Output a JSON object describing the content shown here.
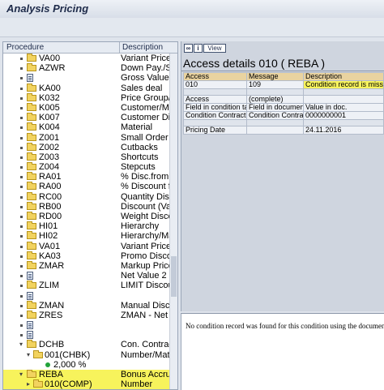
{
  "title": "Analysis Pricing",
  "tree": {
    "headers": {
      "procedure": "Procedure",
      "description": "Description"
    },
    "rows": [
      {
        "proc": "VA00",
        "desc": "Variant Price",
        "icon": "folder",
        "level": 1
      },
      {
        "proc": "AZWR",
        "desc": "Down Pay./Se",
        "icon": "folder",
        "level": 1
      },
      {
        "proc": "",
        "desc": "Gross Value",
        "icon": "doc",
        "level": 1
      },
      {
        "proc": "KA00",
        "desc": "Sales deal",
        "icon": "folder",
        "level": 1
      },
      {
        "proc": "K032",
        "desc": "Price Group/M",
        "icon": "folder",
        "level": 1
      },
      {
        "proc": "K005",
        "desc": "Customer/Mat",
        "icon": "folder",
        "level": 1
      },
      {
        "proc": "K007",
        "desc": "Customer Disc",
        "icon": "folder",
        "level": 1
      },
      {
        "proc": "K004",
        "desc": "Material",
        "icon": "folder",
        "level": 1
      },
      {
        "proc": "Z001",
        "desc": "Small Order",
        "icon": "folder",
        "level": 1
      },
      {
        "proc": "Z002",
        "desc": "Cutbacks",
        "icon": "folder",
        "level": 1
      },
      {
        "proc": "Z003",
        "desc": "Shortcuts",
        "icon": "folder",
        "level": 1
      },
      {
        "proc": "Z004",
        "desc": "Stepcuts",
        "icon": "folder",
        "level": 1
      },
      {
        "proc": "RA01",
        "desc": "% Disc.from G",
        "icon": "folder",
        "level": 1
      },
      {
        "proc": "RA00",
        "desc": "% Discount fr",
        "icon": "folder",
        "level": 1
      },
      {
        "proc": "RC00",
        "desc": "Quantity Disco",
        "icon": "folder",
        "level": 1
      },
      {
        "proc": "RB00",
        "desc": "Discount (Valu",
        "icon": "folder",
        "level": 1
      },
      {
        "proc": "RD00",
        "desc": "Weight Discou",
        "icon": "folder",
        "level": 1
      },
      {
        "proc": "HI01",
        "desc": "Hierarchy",
        "icon": "folder",
        "level": 1
      },
      {
        "proc": "HI02",
        "desc": "Hierarchy/Mat",
        "icon": "folder",
        "level": 1
      },
      {
        "proc": "VA01",
        "desc": "Variant Price",
        "icon": "folder",
        "level": 1
      },
      {
        "proc": "KA03",
        "desc": "Promo Discou",
        "icon": "folder",
        "level": 1
      },
      {
        "proc": "ZMAR",
        "desc": "Markup Price",
        "icon": "folder",
        "level": 1
      },
      {
        "proc": "",
        "desc": "Net Value 2",
        "icon": "doc",
        "level": 1
      },
      {
        "proc": "ZLIM",
        "desc": "LIMIT Discoun",
        "icon": "folder",
        "level": 1
      },
      {
        "proc": "",
        "desc": "",
        "icon": "doc",
        "level": 1
      },
      {
        "proc": "ZMAN",
        "desc": "Manual Discou",
        "icon": "folder",
        "level": 1
      },
      {
        "proc": "ZRES",
        "desc": "ZMAN - Net Va",
        "icon": "folder",
        "level": 1
      },
      {
        "proc": "",
        "desc": "",
        "icon": "doc",
        "level": 1
      },
      {
        "proc": "",
        "desc": "",
        "icon": "doc",
        "level": 1
      },
      {
        "proc": "DCHB",
        "desc": "Con. Contract",
        "icon": "folder-open",
        "level": 1
      },
      {
        "proc": "001(CHBK)",
        "desc": "Number/Mater",
        "icon": "folder-open",
        "level": 2
      },
      {
        "proc": "2,000 %",
        "desc": "",
        "icon": "ball",
        "level": 3
      },
      {
        "proc": "REBA",
        "desc": "Bonus Accrual",
        "icon": "folder-open",
        "level": 1,
        "selected": true
      },
      {
        "proc": "010(COMP)",
        "desc": "Number",
        "icon": "folder",
        "level": 2,
        "selected": true
      }
    ]
  },
  "detail": {
    "toolbar": {
      "view_label": "View"
    },
    "title": "Access details 010 ( REBA )",
    "table1": {
      "headers": [
        "Access",
        "Message",
        "Description"
      ],
      "row": [
        "010",
        "109",
        "Condition record is missing"
      ]
    },
    "table2": {
      "row1": [
        "Access",
        "(complete)",
        ""
      ],
      "headers": [
        "Field in condition table",
        "Field in document",
        "Value in doc."
      ],
      "row": [
        "Condition Contract",
        "Condition Contract",
        "0000000001"
      ]
    },
    "table3": {
      "row": [
        "Pricing Date",
        "",
        "24.11.2016"
      ]
    }
  },
  "message": "No condition record was found for this condition using the document e"
}
